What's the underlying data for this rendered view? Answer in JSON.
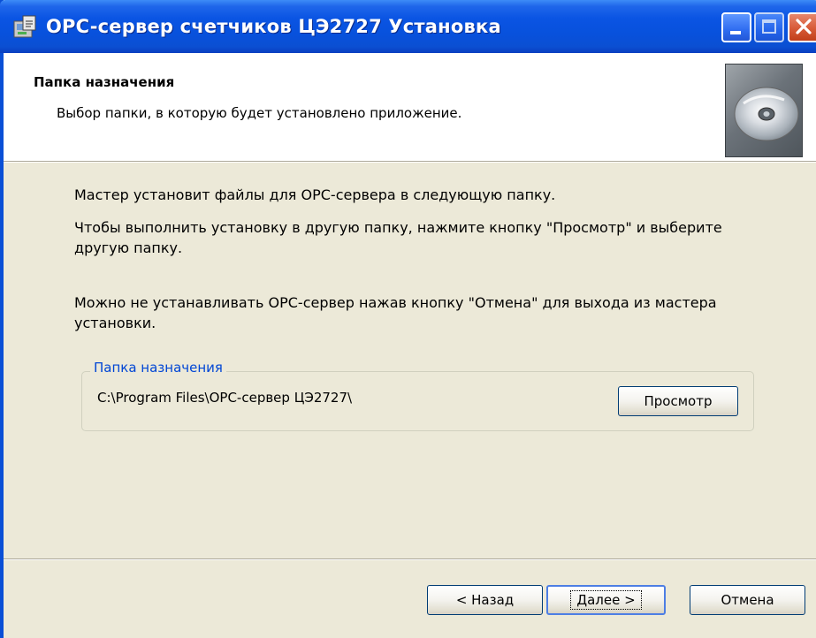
{
  "window": {
    "title": "OPC-сервер счетчиков ЦЭ2727 Установка",
    "titlebar_color": "#0a54e3"
  },
  "header": {
    "title": "Папка назначения",
    "subtitle": "Выбор папки, в которую будет установлено приложение."
  },
  "body": {
    "text1": "Мастер установит файлы для OPC-сервера  в следующую папку.",
    "text2": "Чтобы выполнить установку в другую папку, нажмите кнопку \"Просмотр\" и выберите другую папку.",
    "text3": "Можно не устанавливать OPC-сервер нажав кнопку \"Отмена\" для выхода из мастера установки."
  },
  "destination": {
    "legend": "Папка назначения",
    "path": "C:\\Program Files\\OPC-сервер ЦЭ2727\\",
    "browse_label": "Просмотр"
  },
  "footer": {
    "back_label": "< Назад",
    "next_label": "Далее >",
    "cancel_label": "Отмена"
  },
  "icons": [
    "installer-icon",
    "minimize-icon",
    "maximize-icon",
    "close-icon",
    "cd-disc-icon"
  ]
}
